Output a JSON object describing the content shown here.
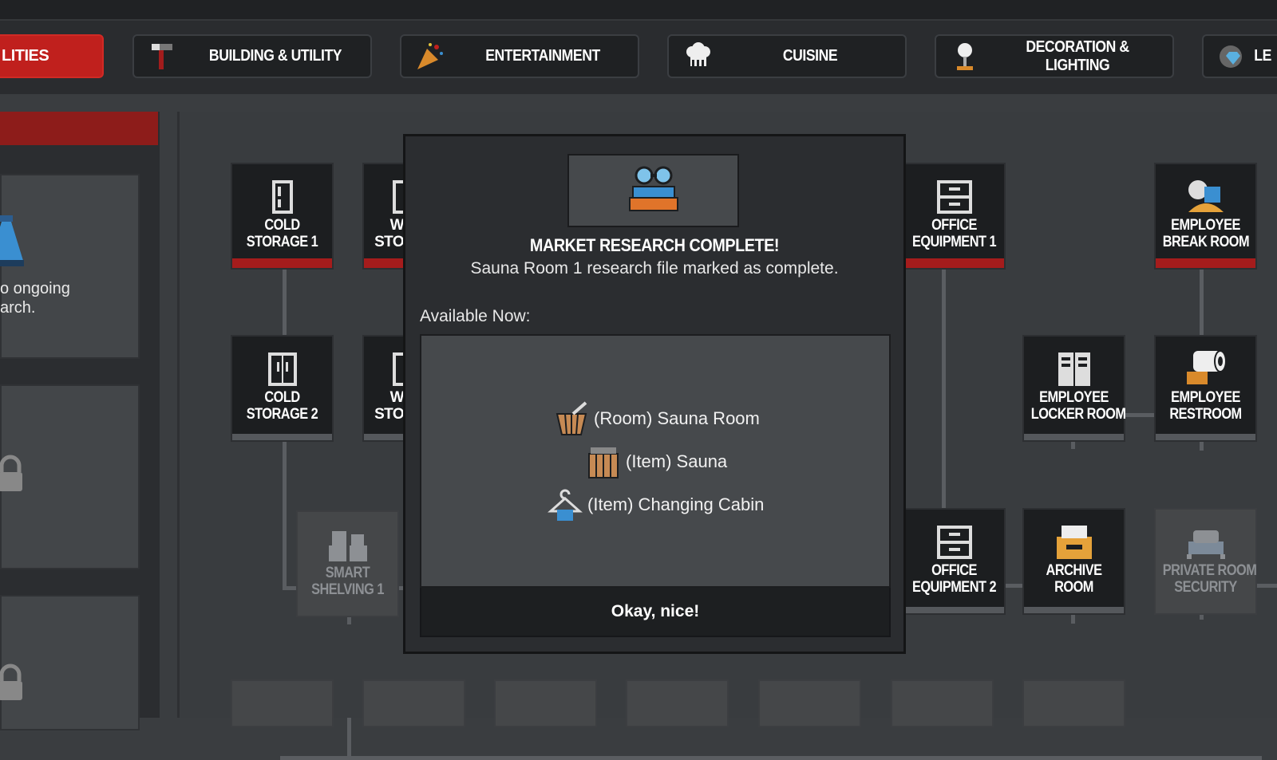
{
  "tabs": [
    {
      "label": "LITIES",
      "icon": "utilities-icon",
      "active": true
    },
    {
      "label": "BUILDING & UTILITY",
      "icon": "hammer-icon"
    },
    {
      "label": "ENTERTAINMENT",
      "icon": "party-popper-icon"
    },
    {
      "label": "CUISINE",
      "icon": "chef-hat-icon"
    },
    {
      "label": "DECORATION & LIGHTING",
      "icon": "lamp-icon"
    },
    {
      "label": "LE",
      "icon": "diamond-head-icon"
    }
  ],
  "left_panel": {
    "research_status": "o ongoing\narch."
  },
  "tree_nodes": [
    {
      "label": "COLD\nSTORAGE 1",
      "icon": "fridge-icon"
    },
    {
      "label": "W\nSTO",
      "icon": "fridge-icon"
    },
    {
      "label": "COLD\nSTORAGE 2",
      "icon": "double-fridge-icon"
    },
    {
      "label": "W\nSTO",
      "icon": "fridge-icon"
    },
    {
      "label": "SMART\nSHELVING 1",
      "icon": "boxes-icon"
    },
    {
      "label": "OFFICE\nEQUIPMENT 1",
      "icon": "filing-cabinet-icon"
    },
    {
      "label": "EMPLOYEE\nBREAK ROOM",
      "icon": "coffee-break-icon"
    },
    {
      "label": "EMPLOYEE\nLOCKER ROOM",
      "icon": "locker-icon"
    },
    {
      "label": "EMPLOYEE\nRESTROOM",
      "icon": "toilet-paper-icon"
    },
    {
      "label": "OFFICE\nEQUIPMENT 2",
      "icon": "filing-cabinet-icon"
    },
    {
      "label": "ARCHIVE\nROOM",
      "icon": "archive-box-icon"
    },
    {
      "label": "PRIVATE ROOM\nSECURITY",
      "icon": "security-bed-icon"
    }
  ],
  "modal": {
    "icon": "market-research-icon",
    "title": "MARKET RESEARCH COMPLETE!",
    "subtitle": "Sauna Room 1 research file marked as complete.",
    "available_label": "Available Now:",
    "items": [
      {
        "label": "(Room) Sauna Room",
        "icon": "sauna-bucket-icon"
      },
      {
        "label": "(Item) Sauna",
        "icon": "sauna-icon"
      },
      {
        "label": "(Item) Changing Cabin",
        "icon": "hanger-icon"
      }
    ],
    "ok_label": "Okay, nice!"
  },
  "colors": {
    "accent_red": "#c0201d",
    "dark_red": "#8d1c1a",
    "background": "#393c3f",
    "node_bg": "#1c1e20"
  }
}
